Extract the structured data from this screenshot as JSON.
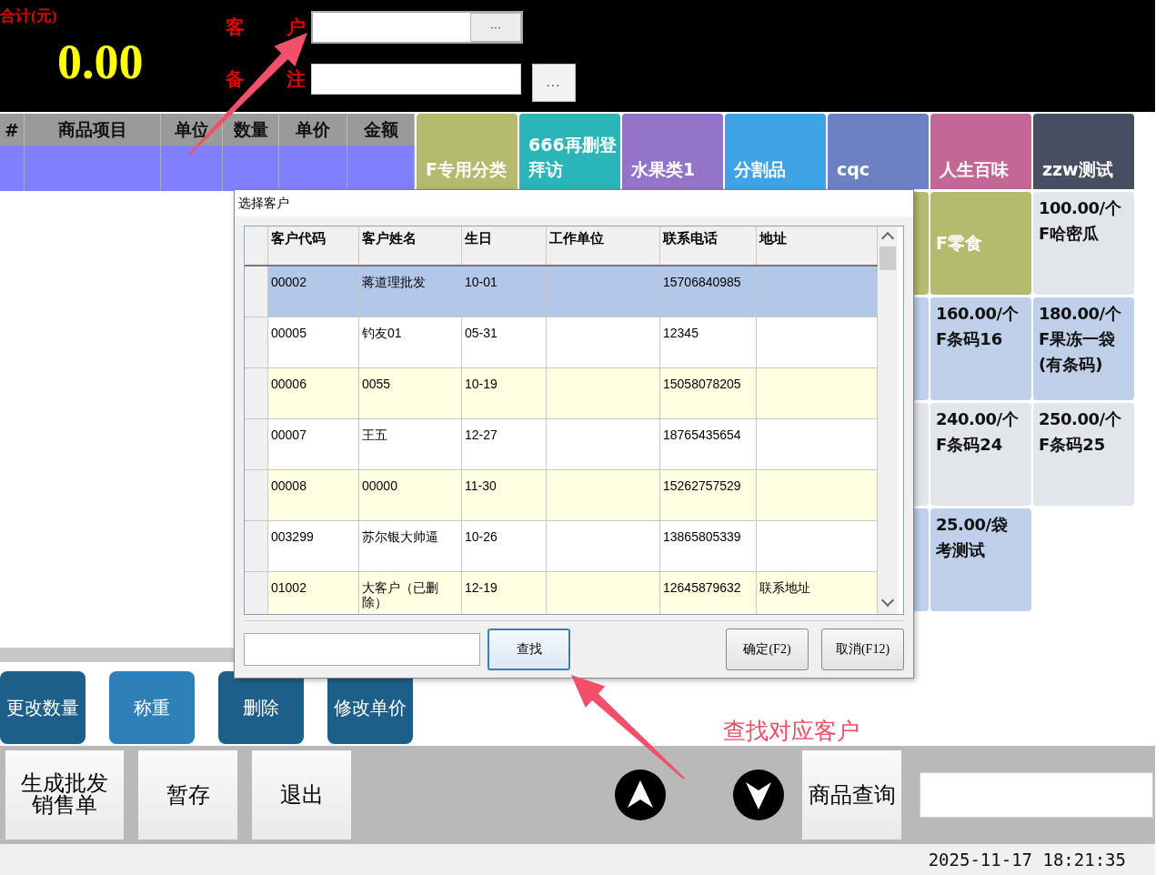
{
  "header": {
    "total_label": "合计(元)",
    "total": "0.00",
    "customer_label": "客户",
    "customer_field": {
      "button": "···"
    },
    "remark_label": "备注",
    "remark_field": {
      "button": "..."
    }
  },
  "order_table": {
    "columns": [
      "#",
      "商品项目",
      "单位",
      "数量",
      "单价",
      "金额"
    ],
    "rows": [
      {
        "selected": true
      }
    ]
  },
  "categories": [
    {
      "lines": [
        "F专用分类"
      ],
      "color": "#b5bb6e"
    },
    {
      "lines": [
        "666再删登",
        "拜访"
      ],
      "color": "#2ab5b8"
    },
    {
      "lines": [
        "水果类1"
      ],
      "color": "#9474c8"
    },
    {
      "lines": [
        "分割品"
      ],
      "color": "#3fa3e8"
    },
    {
      "lines": [
        "cqc"
      ],
      "color": "#6c80c4"
    },
    {
      "lines": [
        "人生百味"
      ],
      "color": "#c36896"
    },
    {
      "lines": [
        "zzw测试"
      ],
      "color": "#474e61"
    }
  ],
  "product_rows": [
    [
      {
        "kind": "category",
        "color": "#b5bb6e"
      },
      {
        "kind": "category",
        "name": "F零食",
        "color": "#b5bb6e"
      },
      {
        "kind": "product",
        "price": "100.00/个",
        "name": "F哈密瓜",
        "color": "#e2e5ea"
      }
    ],
    [
      {
        "kind": "product",
        "color": "#c0d0ea"
      },
      {
        "kind": "product",
        "price": "160.00/个",
        "name": "F条码16",
        "color": "#c0d0ea"
      },
      {
        "kind": "product",
        "price": "180.00/个",
        "name": "F果冻一袋(有条码)",
        "color": "#c0d0ea"
      }
    ],
    [
      {
        "kind": "product",
        "color": "#e2e5ea"
      },
      {
        "kind": "product",
        "price": "240.00/个",
        "name": "F条码24",
        "color": "#e2e5ea"
      },
      {
        "kind": "product",
        "price": "250.00/个",
        "name": "F条码25",
        "color": "#e2e5ea"
      }
    ],
    [
      {
        "kind": "product",
        "color": "#c0d0ea"
      },
      {
        "kind": "product",
        "price": "25.00/袋",
        "name": "考测试",
        "color": "#c0d0ea"
      }
    ]
  ],
  "actions": [
    {
      "label": "更改数量",
      "color": "#1e5f8a"
    },
    {
      "label": "称重",
      "color": "#2f80b8"
    },
    {
      "label": "删除",
      "color": "#1e5f8a"
    },
    {
      "label": "修改单价",
      "color": "#1e5f8a"
    }
  ],
  "bottom_buttons": [
    "生成批发销售单",
    "暂存",
    "退出"
  ],
  "product_search": {
    "button": "商品查询"
  },
  "status_bar": {
    "datetime": "2025-11-17  18:21:35"
  },
  "dialog": {
    "title": "选择客户",
    "columns": [
      "客户代码",
      "客户姓名",
      "生日",
      "工作单位",
      "联系电话",
      "地址"
    ],
    "rows": [
      {
        "cells": [
          "00002",
          "蒋道理批发",
          "10-01",
          "",
          "15706840985",
          ""
        ],
        "selected": true
      },
      {
        "cells": [
          "00005",
          "钓友01",
          "05-31",
          "",
          "12345",
          ""
        ],
        "selected": false
      },
      {
        "cells": [
          "00006",
          "0055",
          "10-19",
          "",
          "15058078205",
          ""
        ],
        "selected": false
      },
      {
        "cells": [
          "00007",
          "王五",
          "12-27",
          "",
          "18765435654",
          ""
        ],
        "selected": false
      },
      {
        "cells": [
          "00008",
          "00000",
          "11-30",
          "",
          "15262757529",
          ""
        ],
        "selected": false
      },
      {
        "cells": [
          "003299",
          "苏尔银大帅逼",
          "10-26",
          "",
          "13865805339",
          ""
        ],
        "selected": false
      },
      {
        "cells": [
          "01002",
          "大客户（已删除）",
          "12-19",
          "",
          "12645879632",
          "联系地址"
        ],
        "selected": false
      }
    ],
    "buttons": [
      {
        "kind": "search",
        "label": "查找",
        "focused": true
      },
      {
        "kind": "ok",
        "label": "确定(F2)",
        "focused": false
      },
      {
        "kind": "cancel",
        "label": "取消(F12)",
        "focused": false
      }
    ]
  },
  "annotation": {
    "text": "查找对应客户"
  }
}
